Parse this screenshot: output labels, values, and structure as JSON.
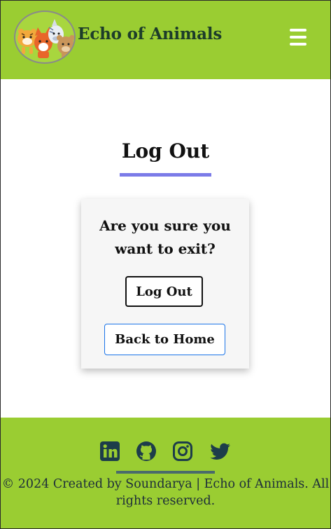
{
  "header": {
    "brand": "Echo of Animals",
    "logo_icon": "animal-group-logo",
    "menu_icon": "hamburger-menu-icon",
    "background_color": "#9acd32"
  },
  "main": {
    "title": "Log Out",
    "accent_color": "#7b7be8",
    "card": {
      "question": "Are you sure you want to exit?",
      "logout_label": "Log Out",
      "home_label": "Back to Home"
    }
  },
  "footer": {
    "social_icons": [
      "linkedin-icon",
      "github-icon",
      "instagram-icon",
      "twitter-icon"
    ],
    "copyright": "© 2024 Created by Soundarya | Echo of Animals. All rights reserved.",
    "background_color": "#9acd32"
  }
}
